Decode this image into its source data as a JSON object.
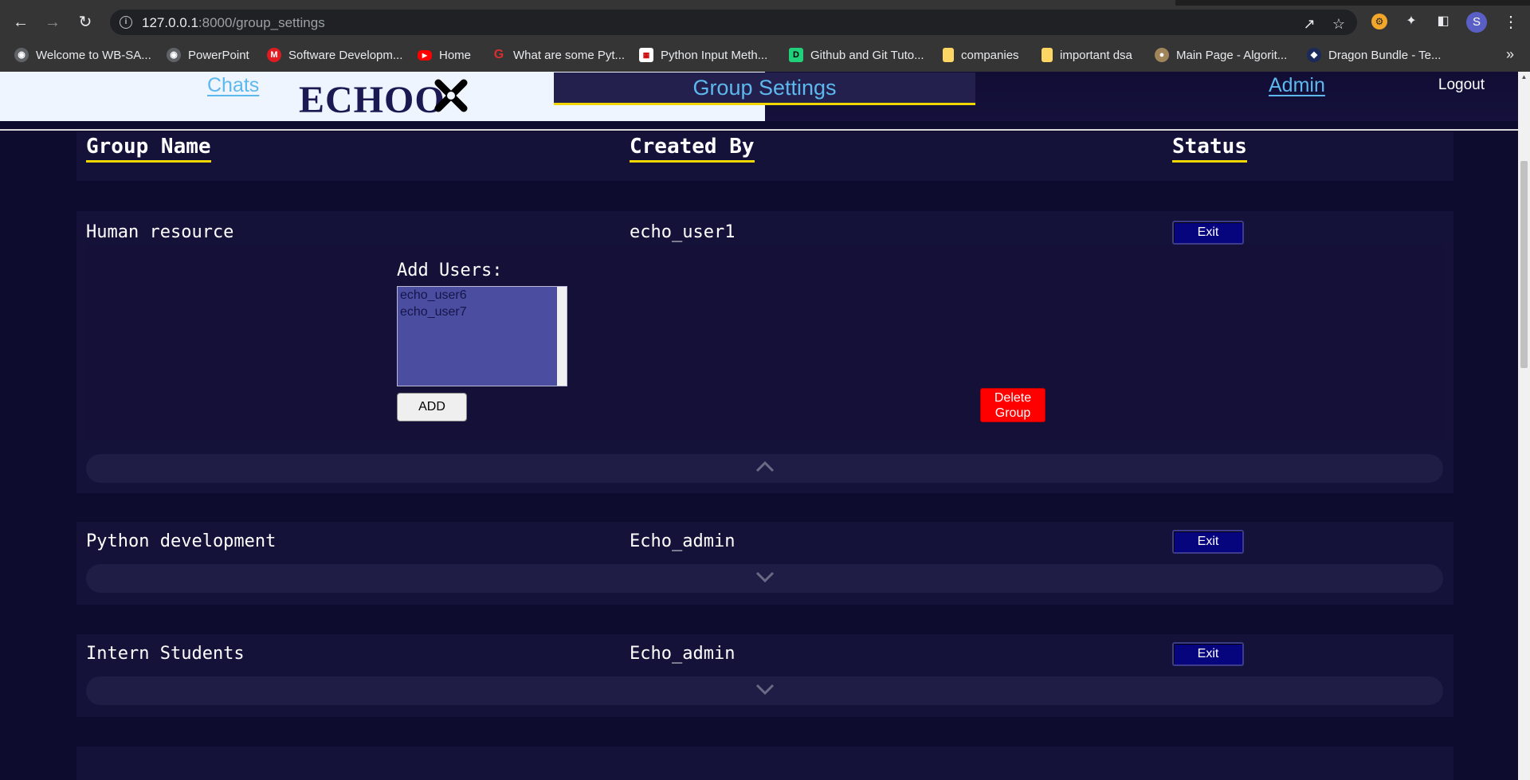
{
  "browser": {
    "url_host": "127.0.0.1",
    "url_path": ":8000/group_settings",
    "profile_initial": "S",
    "bookmarks": [
      {
        "label": "Welcome to WB-SA...",
        "icon": "globe-icon",
        "color": "#5f6368"
      },
      {
        "label": "PowerPoint",
        "icon": "globe-icon",
        "color": "#5f6368"
      },
      {
        "label": "Software Developm...",
        "icon": "m-logo-icon",
        "color": "#e01b22"
      },
      {
        "label": "Home",
        "icon": "youtube-icon",
        "color": "#ff0000"
      },
      {
        "label": "What are some Pyt...",
        "icon": "quora-icon",
        "color": "#d92f2f"
      },
      {
        "label": "Python Input Meth...",
        "icon": "page-icon",
        "color": "#ffffff"
      },
      {
        "label": "Github and Git Tuto...",
        "icon": "dc-icon",
        "color": "#21d07a"
      },
      {
        "label": "companies",
        "icon": "folder-icon",
        "color": "#fdd663"
      },
      {
        "label": "important dsa",
        "icon": "folder-icon",
        "color": "#fdd663"
      },
      {
        "label": "Main Page - Algorit...",
        "icon": "algo-icon",
        "color": "#a0855b"
      },
      {
        "label": "Dragon Bundle - Te...",
        "icon": "dragon-icon",
        "color": "#1b2a5a"
      }
    ]
  },
  "app": {
    "logo_text": "ECHOO",
    "logout_label": "Logout",
    "nav": {
      "chats": "Chats",
      "group_settings": "Group Settings",
      "admin": "Admin"
    },
    "colors": {
      "accent_yellow": "#f2d600",
      "link_blue": "#5db8ee",
      "exit_blue": "#07057e",
      "delete_red": "#ff0000"
    }
  },
  "table": {
    "headers": {
      "name": "Group Name",
      "created_by": "Created By",
      "status": "Status"
    },
    "groups": [
      {
        "name": "Human resource",
        "created_by": "echo_user1",
        "status_button": "Exit",
        "expanded": true,
        "add_users_label": "Add Users:",
        "user_options": [
          "echo_user6",
          "echo_user7"
        ],
        "add_button": "ADD",
        "delete_button_line1": "Delete",
        "delete_button_line2": "Group"
      },
      {
        "name": "Python development",
        "created_by": "Echo_admin",
        "status_button": "Exit",
        "expanded": false
      },
      {
        "name": "Intern Students",
        "created_by": "Echo_admin",
        "status_button": "Exit",
        "expanded": false
      }
    ]
  }
}
